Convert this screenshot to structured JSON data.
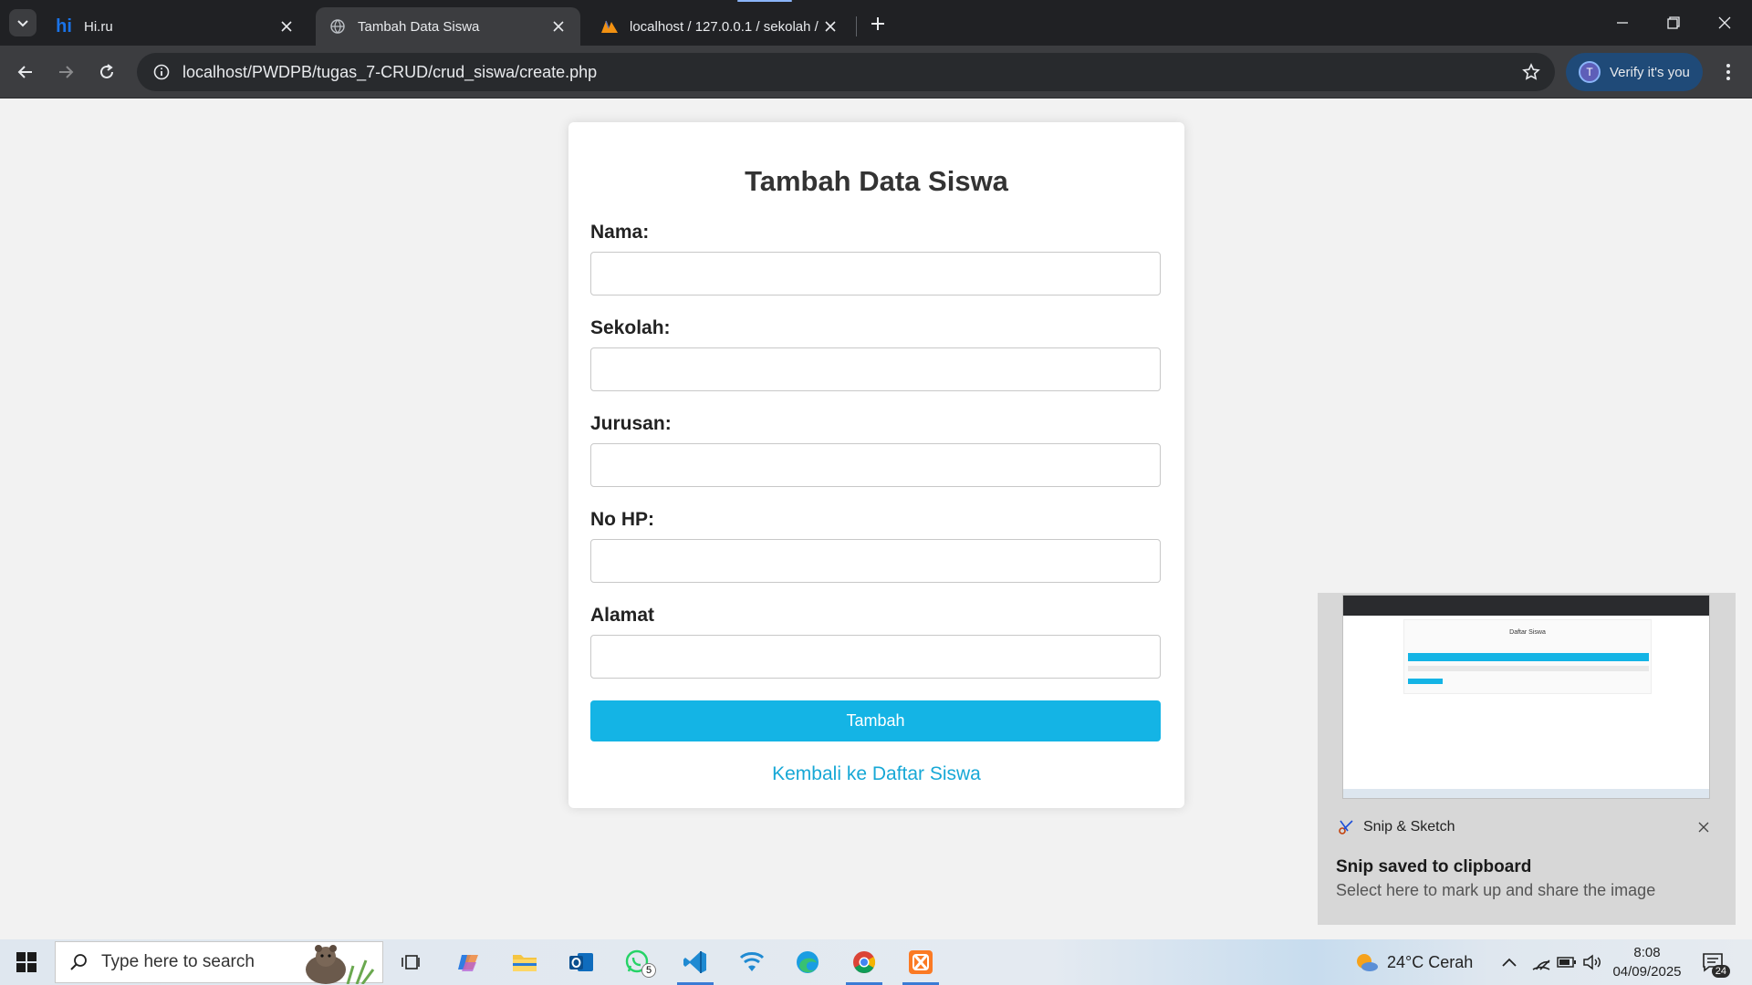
{
  "browser": {
    "tabs": [
      {
        "title": "Hi.ru",
        "favicon": "hi-ru-logo",
        "active": false
      },
      {
        "title": "Tambah Data Siswa",
        "favicon": "globe-icon",
        "active": true
      },
      {
        "title": "localhost / 127.0.0.1 / sekolah /",
        "favicon": "phpmyadmin-icon",
        "active": false
      }
    ],
    "url": "localhost/PWDPB/tugas_7-CRUD/crud_siswa/create.php",
    "profile_button": "Verify it's you",
    "profile_initial": "T"
  },
  "form": {
    "title": "Tambah Data Siswa",
    "fields": [
      {
        "label": "Nama:",
        "value": ""
      },
      {
        "label": "Sekolah:",
        "value": ""
      },
      {
        "label": "Jurusan:",
        "value": ""
      },
      {
        "label": "No HP:",
        "value": ""
      },
      {
        "label": "Alamat",
        "value": ""
      }
    ],
    "submit_label": "Tambah",
    "back_link": "Kembali ke Daftar Siswa"
  },
  "toast": {
    "app_name": "Snip & Sketch",
    "title": "Snip saved to clipboard",
    "body": "Select here to mark up and share the image",
    "thumbnail_title": "Daftar Siswa"
  },
  "taskbar": {
    "search_placeholder": "Type here to search",
    "whatsapp_badge": "5",
    "weather": "24°C Cerah",
    "time": "8:08",
    "date": "04/09/2025",
    "notification_count": "24"
  },
  "colors": {
    "accent": "#14b4e5",
    "link": "#17a8d6",
    "chrome_dark": "#202124",
    "chrome_toolbar": "#3c3d40"
  }
}
